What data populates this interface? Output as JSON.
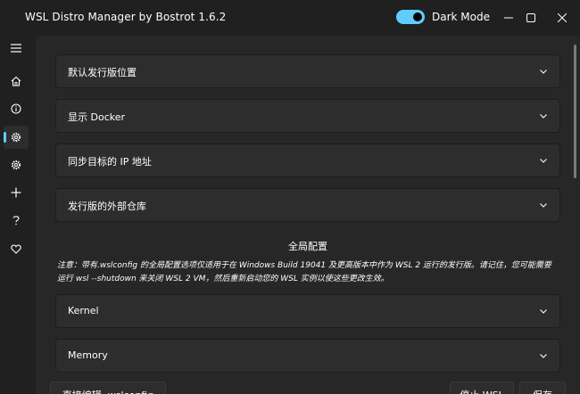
{
  "app": {
    "title": "WSL Distro Manager by Bostrot 1.6.2",
    "theme_toggle_label": "Dark Mode",
    "theme_toggle_on": true,
    "accent_color": "#60cdff"
  },
  "window_controls": {
    "minimize_icon": "minimize-icon",
    "maximize_icon": "maximize-icon",
    "close_icon": "close-icon"
  },
  "sidebar": {
    "items": [
      {
        "icon": "menu-icon",
        "active": false
      },
      {
        "icon": "home-icon",
        "active": false
      },
      {
        "icon": "info-icon",
        "active": false
      },
      {
        "icon": "settings-icon",
        "active": true
      },
      {
        "icon": "settings-alt-icon",
        "active": false
      },
      {
        "icon": "add-icon",
        "active": false
      },
      {
        "icon": "help-icon",
        "active": false
      },
      {
        "icon": "heart-icon",
        "active": false
      }
    ]
  },
  "settings": {
    "expanders": [
      {
        "label": "默认发行版位置"
      },
      {
        "label": "显示 Docker"
      },
      {
        "label": "同步目标的 IP 地址"
      },
      {
        "label": "发行版的外部仓库"
      }
    ],
    "global_section_title": "全局配置",
    "global_note": "注意：带有.wslconfig 的全局配置选项仅适用于在 Windows Build 19041 及更高版本中作为 WSL 2 运行的发行版。请记住，您可能需要运行 wsl --shutdown 来关闭 WSL 2 VM，然后重新启动您的 WSL 实例以使这些更改生效。",
    "global_expanders": [
      {
        "label": "Kernel"
      },
      {
        "label": "Memory"
      }
    ]
  },
  "footer": {
    "edit_button_label": "直接编辑 .wslconfig",
    "stop_button_label": "停止 WSL",
    "save_button_label": "保存"
  }
}
